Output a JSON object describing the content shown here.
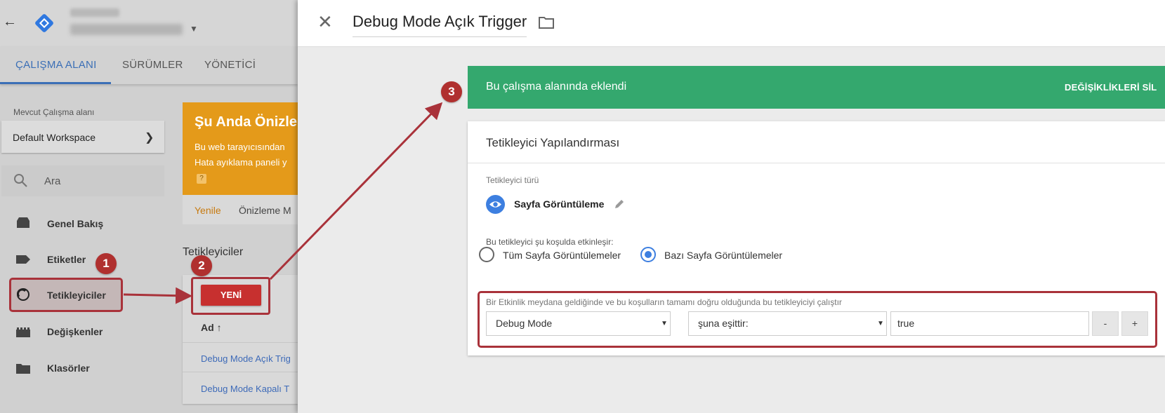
{
  "left": {
    "tabs": [
      "ÇALIŞMA ALANI",
      "SÜRÜMLER",
      "YÖNETİCİ"
    ],
    "workspace": {
      "label": "Mevcut Çalışma alanı",
      "name": "Default Workspace"
    },
    "search": {
      "placeholder": "Ara"
    },
    "nav": [
      "Genel Bakış",
      "Etiketler",
      "Tetikleyiciler",
      "Değişkenler",
      "Klasörler"
    ],
    "preview": {
      "title": "Şu Anda Önizle",
      "line1": "Bu web tarayıcısından",
      "line2": "Hata ayıklama paneli y",
      "help": "?",
      "refresh": "Yenile",
      "mode": "Önizleme M"
    },
    "triggers": {
      "title": "Tetikleyiciler",
      "new_button": "YENİ",
      "col_name": "Ad",
      "sort_icon": "↑",
      "rows": [
        "Debug Mode Açık Trig",
        "Debug Mode Kapalı T"
      ]
    }
  },
  "panel": {
    "title": "Debug Mode Açık Trigger",
    "banner": {
      "text": "Bu çalışma alanında eklendi",
      "action": "DEĞİŞİKLİKLERİ SİL"
    },
    "config": {
      "title": "Tetikleyici Yapılandırması",
      "type_label": "Tetikleyici türü",
      "type_name": "Sayfa Görüntüleme",
      "fire_label": "Bu tetikleyici şu koşulda etkinleşir:",
      "radio_all": "Tüm Sayfa Görüntülemeler",
      "radio_some": "Bazı Sayfa Görüntülemeler",
      "condition_label": "Bir Etkinlik meydana geldiğinde ve bu koşulların tamamı doğru olduğunda bu tetikleyiciyi çalıştır",
      "variable": "Debug Mode",
      "operator": "şuna eşittir:",
      "value": "true",
      "minus": "-",
      "plus": "+"
    }
  },
  "callouts": [
    "1",
    "2",
    "3"
  ],
  "colors": {
    "accent": "#3b6fb6",
    "banner": "#34a86e",
    "highlight": "#a9323a",
    "new_button": "#c7302f",
    "preview": "#e49a1a"
  }
}
